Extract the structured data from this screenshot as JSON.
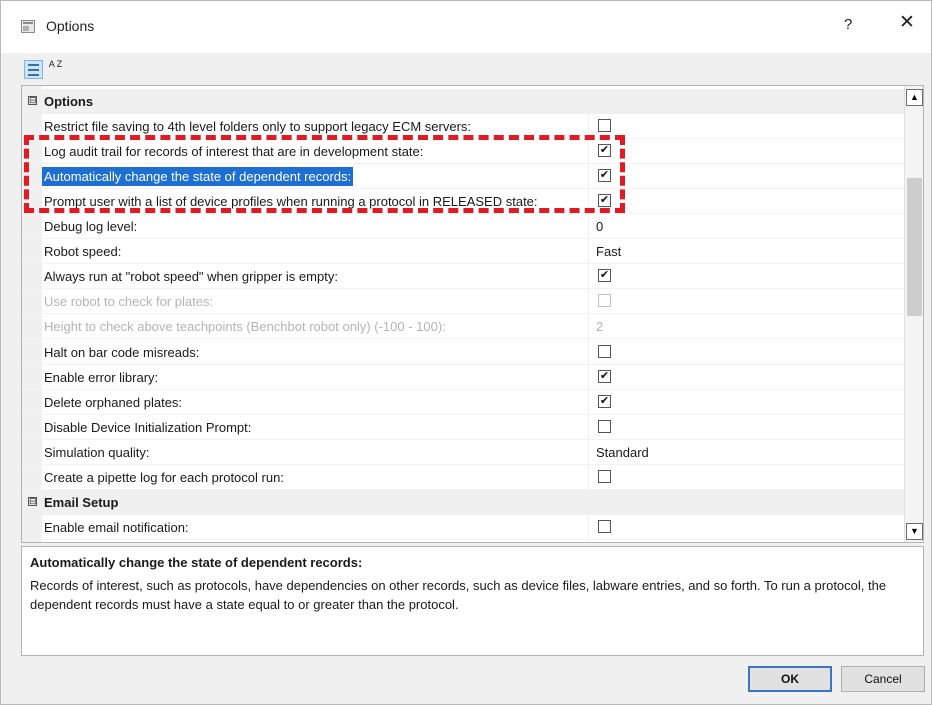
{
  "window": {
    "title": "Options",
    "help_label": "?",
    "close_label": "✕"
  },
  "toolbar": {
    "categorized_icon": "categorized-view-icon",
    "alphabetical_icon": "sort-az-icon",
    "alpha_label": "A Z"
  },
  "grid": {
    "rows": [
      {
        "kind": "category",
        "label": "Options",
        "expander": "⊟"
      },
      {
        "kind": "check",
        "label": "Restrict file saving to 4th level folders only to support legacy ECM servers:",
        "checked": false
      },
      {
        "kind": "check",
        "label": "Log audit trail for records of interest that are in development state:",
        "checked": true
      },
      {
        "kind": "check",
        "label": "Automatically change the state of dependent records:",
        "checked": true,
        "selected": true
      },
      {
        "kind": "check",
        "label": "Prompt user with a list of device profiles when running a protocol in RELEASED state:",
        "checked": true
      },
      {
        "kind": "text",
        "label": "Debug log level:",
        "value": "0"
      },
      {
        "kind": "text",
        "label": "Robot speed:",
        "value": "Fast"
      },
      {
        "kind": "check",
        "label": "Always run at \"robot speed\" when gripper is empty:",
        "checked": true
      },
      {
        "kind": "check",
        "label": "Use robot to check for plates:",
        "checked": false,
        "disabled": true
      },
      {
        "kind": "text",
        "label": "Height to check above teachpoints (Benchbot robot only) (-100 - 100):",
        "value": "2",
        "disabled": true
      },
      {
        "kind": "check",
        "label": "Halt on bar code misreads:",
        "checked": false
      },
      {
        "kind": "check",
        "label": "Enable error library:",
        "checked": true
      },
      {
        "kind": "check",
        "label": "Delete orphaned plates:",
        "checked": true
      },
      {
        "kind": "check",
        "label": "Disable Device Initialization Prompt:",
        "checked": false
      },
      {
        "kind": "text",
        "label": "Simulation quality:",
        "value": "Standard"
      },
      {
        "kind": "check",
        "label": "Create a pipette log for each protocol run:",
        "checked": false
      },
      {
        "kind": "category",
        "label": "Email Setup",
        "expander": "⊟"
      },
      {
        "kind": "check",
        "label": "Enable email notification:",
        "checked": false
      }
    ],
    "check_mark": "✔"
  },
  "scrollbar": {
    "up": "▲",
    "down": "▼"
  },
  "description": {
    "title": "Automatically change the state of dependent records:",
    "text": "Records of interest, such as protocols, have dependencies on other records, such as device files, labware entries, and so forth.  To run a protocol, the dependent records must have a state equal to or greater than the protocol."
  },
  "buttons": {
    "ok": "OK",
    "cancel": "Cancel"
  },
  "colors": {
    "selection": "#1e6fd3",
    "highlight_border": "#e01b24"
  }
}
